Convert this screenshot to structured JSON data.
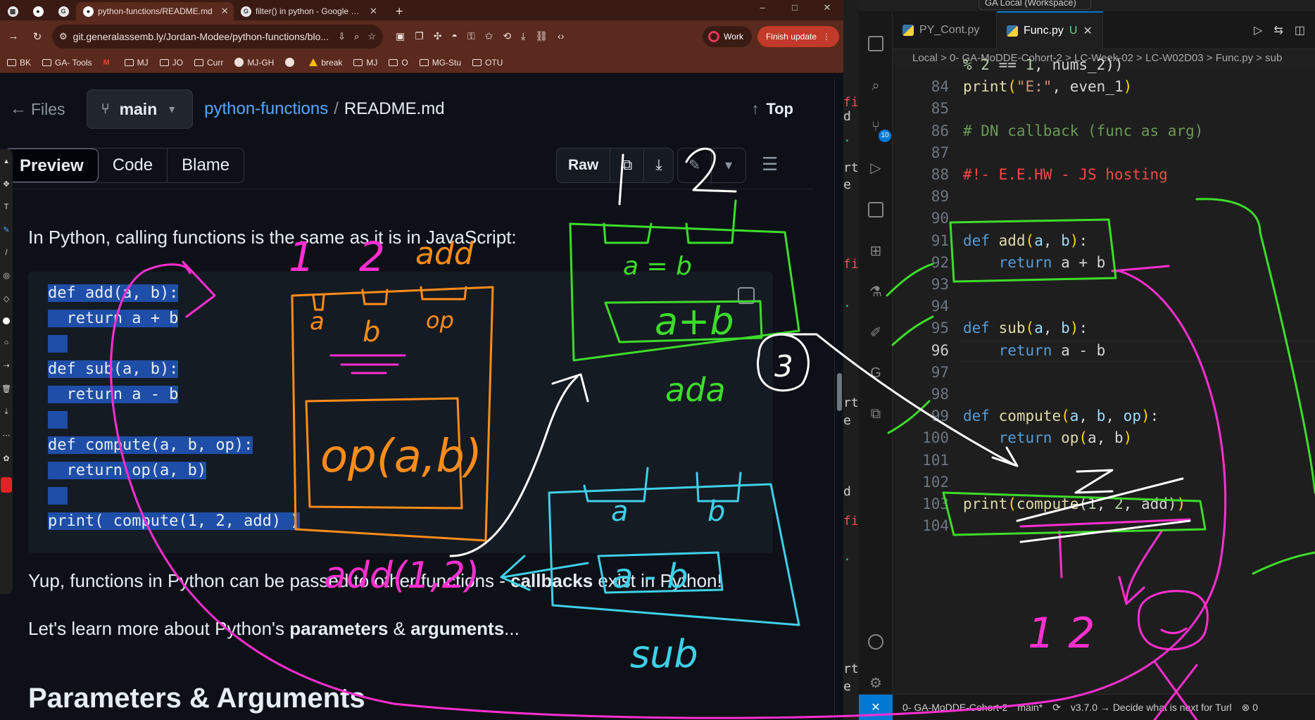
{
  "browser": {
    "tabs": [
      {
        "label": "",
        "icon": "app-icon"
      },
      {
        "label": "",
        "icon": "github-icon"
      },
      {
        "label": "",
        "icon": "google-icon"
      },
      {
        "label": "python-functions/README.md",
        "icon": "github-icon",
        "active": true
      },
      {
        "label": "filter() in python - Google Search",
        "icon": "google-icon"
      }
    ],
    "new_tab_label": "+",
    "window_controls": [
      "–",
      "□",
      "✕"
    ],
    "url": "git.generalassemb.ly/Jordan-Modee/python-functions/blo...",
    "profile_label": "Work",
    "update_label": "Finish update",
    "bookmarks": [
      {
        "label": "BK",
        "icon": "folder-icon"
      },
      {
        "label": "GA- Tools",
        "icon": "folder-icon"
      },
      {
        "label": "",
        "icon": "gmail-icon"
      },
      {
        "label": "MJ",
        "icon": "folder-icon"
      },
      {
        "label": "JO",
        "icon": "folder-icon"
      },
      {
        "label": "Curr",
        "icon": "folder-icon"
      },
      {
        "label": "MJ-GH",
        "icon": "github-icon"
      },
      {
        "label": "",
        "icon": "github-icon"
      },
      {
        "label": "break",
        "icon": "drive-icon"
      },
      {
        "label": "MJ",
        "icon": "folder-icon"
      },
      {
        "label": "O",
        "icon": "folder-icon"
      },
      {
        "label": "MG-Stu",
        "icon": "folder-icon"
      },
      {
        "label": "OTU",
        "icon": "folder-icon"
      }
    ]
  },
  "github": {
    "files_label": "Files",
    "branch": "main",
    "repo": "python-functions",
    "separator": "/",
    "file": "README.md",
    "top_label": "Top",
    "view_tabs": [
      "Preview",
      "Code",
      "Blame"
    ],
    "raw_label": "Raw",
    "intro": "In Python, calling functions is the same as it is in JavaScript:",
    "code_lines": [
      "def add(a, b):",
      "  return a + b",
      "",
      "def sub(a, b):",
      "  return a - b",
      "",
      "def compute(a, b, op):",
      "  return op(a, b)",
      "",
      "print( compute(1, 2, add) )"
    ],
    "para2_a": "Yup, functions in Python can be passed to other functions - ",
    "para2_b": "callbacks",
    "para2_c": " exist in Python!",
    "para3_a": "Let's learn more about Python's ",
    "para3_b": "parameters",
    "para3_c": " & ",
    "para3_d": "arguments",
    "para3_e": "...",
    "heading": "Parameters & Arguments"
  },
  "vscode": {
    "search_label": "GA Local (Workspace)",
    "tabs": [
      {
        "label": "PY_Cont.py",
        "active": false
      },
      {
        "label": "Func.py",
        "status": "U",
        "active": true
      }
    ],
    "breadcrumbs": "Local > 0- GA-MoDDE-Cohort-2 > LC-Week-02 > LC-W02D03 > Func.py > sub",
    "scm_badge": "10",
    "line_numbers": [
      "",
      "84",
      "85",
      "86",
      "87",
      "88",
      "89",
      "90",
      "91",
      "92",
      "93",
      "94",
      "95",
      "96",
      "97",
      "98",
      "99",
      "100",
      "101",
      "102",
      "103",
      "104"
    ],
    "current_line": "96",
    "status": {
      "remote": "✕",
      "folder": "0- GA-MoDDE-Cohort-2",
      "branch": "main*",
      "version": "v3.7.0 → Decide what is next for Turl",
      "problems": "⊗ 0"
    }
  },
  "handwriting": {
    "num_1": "1",
    "num_2": "2",
    "add": "add",
    "a": "a",
    "b": "b",
    "op": "op",
    "op_ab": "op(a,b)",
    "add_12": "add(1,2)",
    "a_plus_b": "a+b",
    "a_eq_b": "a = b",
    "ada": "ada",
    "a_minus_b": "a - b",
    "sub": "sub",
    "three": "3",
    "one_two": "1  2"
  },
  "colors": {
    "ink_pink": "#ff2fd1",
    "ink_orange": "#ff8c1a",
    "ink_green": "#3ddc2b",
    "ink_cyan": "#3fd0e8",
    "ink_white": "#ffffff"
  }
}
